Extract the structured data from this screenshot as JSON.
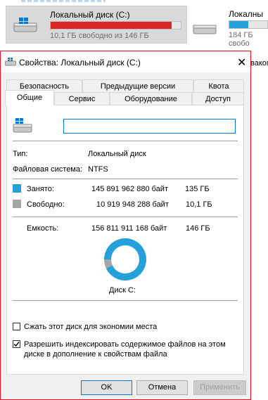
{
  "explorer": {
    "drive1": {
      "name": "Локальный диск (C:)",
      "status": "10,1 ГБ свободно из 146 ГБ",
      "used_fraction": 0.93,
      "bar_color": "#da2626"
    },
    "drive2": {
      "name": "Локалны",
      "status": "184 ГБ свобо",
      "used_fraction": 0.5,
      "bar_color": "#26a0da"
    },
    "side_text": "вакоп"
  },
  "dialog": {
    "title": "Свойства: Локальный диск (C:)",
    "close_glyph": "✕",
    "tabs_row1": [
      "Безопасность",
      "Предыдущие версии",
      "Квота"
    ],
    "tabs_row2": [
      "Общие",
      "Сервис",
      "Оборудование",
      "Доступ"
    ],
    "active_tab": "Общие",
    "volume_label_value": "",
    "type_label": "Тип:",
    "type_value": "Локальный диск",
    "fs_label": "Файловая система:",
    "fs_value": "NTFS",
    "used_label": "Занято:",
    "used_bytes": "145 891 962 880 байт",
    "used_gb": "135 ГБ",
    "used_color": "#26a0da",
    "free_label": "Свободно:",
    "free_bytes": "10 919 948 288 байт",
    "free_gb": "10,1 ГБ",
    "free_color": "#a6a6a6",
    "capacity_label": "Емкость:",
    "capacity_bytes": "156 811 911 168 байт",
    "capacity_gb": "146 ГБ",
    "disk_caption": "Диск C:",
    "compress_label": "Сжать этот диск для экономии места",
    "compress_checked": false,
    "index_label_line1": "Разрешить индексировать содержимое файлов на этом",
    "index_label_line2": "диске в дополнение к свойствам файла",
    "index_checked": true,
    "ok_label": "OK",
    "cancel_label": "Отмена",
    "apply_label": "Применить"
  },
  "chart_data": {
    "type": "pie",
    "categories": [
      "Занято",
      "Свободно"
    ],
    "values": [
      145891962880,
      10919948288
    ],
    "colors": [
      "#26a0da",
      "#a6a6a6"
    ],
    "title": "Диск C:"
  }
}
